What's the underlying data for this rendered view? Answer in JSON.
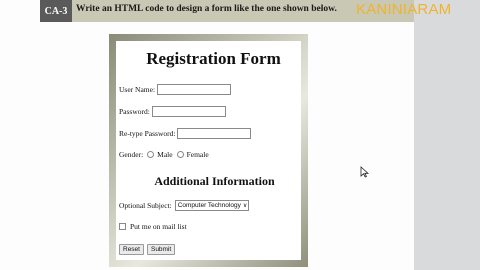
{
  "header": {
    "ca_label": "CA-3",
    "instruction": "Write an HTML code to design a form like the one shown below.",
    "watermark": "KANINIARAM"
  },
  "form": {
    "title": "Registration Form",
    "username_label": "User Name:",
    "username_value": "",
    "password_label": "Password:",
    "password_value": "",
    "retype_label": "Re-type Password:",
    "retype_value": "",
    "gender_label": "Gender:",
    "gender_options": [
      "Male",
      "Female"
    ],
    "additional_title": "Additional Information",
    "subject_label": "Optional Subject:",
    "subject_selected": "Computer Technology",
    "mail_list_label": "Put me on mail list",
    "reset_label": "Reset",
    "submit_label": "Submit"
  },
  "colors": {
    "header_bar": "#c8c8b4",
    "ca_box": "#5a5a5a",
    "watermark": "#f0b330",
    "right_panel": "#d9dadc"
  },
  "icons": {
    "cursor": "mouse-pointer-icon",
    "dropdown": "chevron-down-icon"
  }
}
